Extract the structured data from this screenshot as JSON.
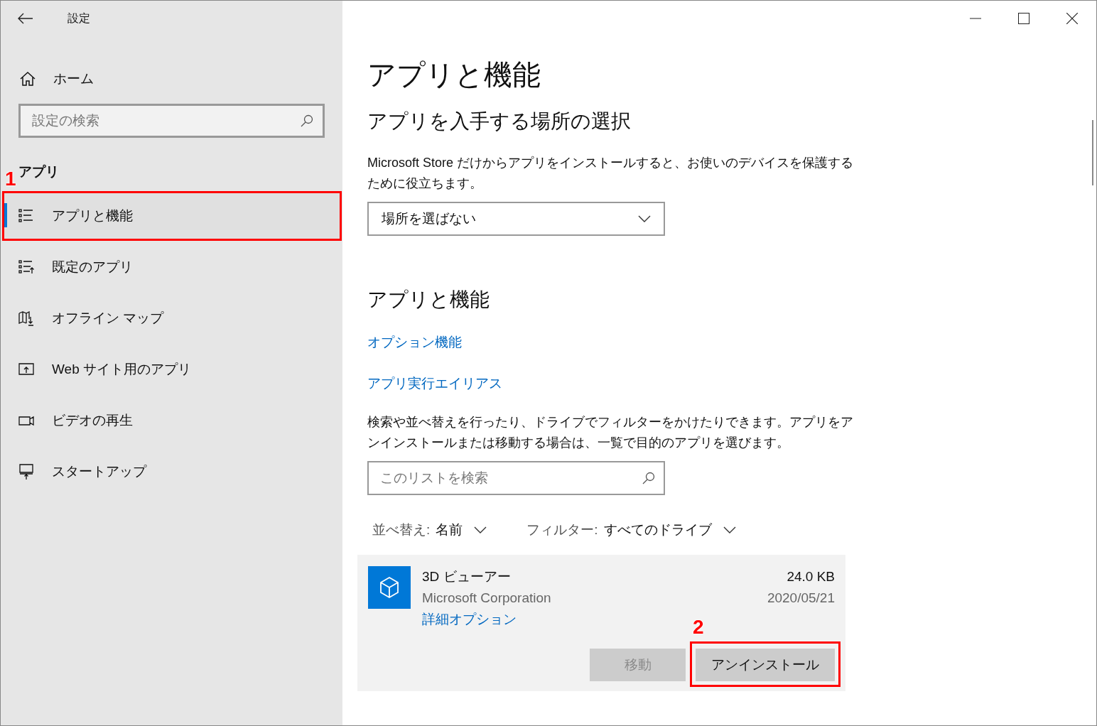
{
  "window": {
    "title": "設定"
  },
  "sidebar": {
    "home": "ホーム",
    "search": {
      "placeholder": "設定の検索"
    },
    "section": "アプリ",
    "items": [
      {
        "label": "アプリと機能",
        "kind": "list",
        "selected": true,
        "annotation": "1"
      },
      {
        "label": "既定のアプリ",
        "kind": "default",
        "selected": false
      },
      {
        "label": "オフライン マップ",
        "kind": "map",
        "selected": false
      },
      {
        "label": "Web サイト用のアプリ",
        "kind": "web",
        "selected": false
      },
      {
        "label": "ビデオの再生",
        "kind": "video",
        "selected": false
      },
      {
        "label": "スタートアップ",
        "kind": "startup",
        "selected": false
      }
    ]
  },
  "main": {
    "title": "アプリと機能",
    "source": {
      "heading": "アプリを入手する場所の選択",
      "description": "Microsoft Store だけからアプリをインストールすると、お使いのデバイスを保護するために役立ちます。",
      "dropdown": "場所を選ばない"
    },
    "apps": {
      "heading": "アプリと機能",
      "links": [
        "オプション機能",
        "アプリ実行エイリアス"
      ],
      "description": "検索や並べ替えを行ったり、ドライブでフィルターをかけたりできます。アプリをアンインストールまたは移動する場合は、一覧で目的のアプリを選びます。",
      "search": {
        "placeholder": "このリストを検索"
      },
      "sort": {
        "label": "並べ替え:",
        "value": "名前"
      },
      "filter": {
        "label": "フィルター:",
        "value": "すべてのドライブ"
      },
      "list": [
        {
          "name": "3D ビューアー",
          "publisher": "Microsoft Corporation",
          "size": "24.0 KB",
          "date": "2020/05/21",
          "link": "詳細オプション",
          "buttons": [
            {
              "label": "移動",
              "disabled": true
            },
            {
              "label": "アンインストール",
              "disabled": false,
              "annotation": "2"
            }
          ]
        }
      ]
    }
  }
}
